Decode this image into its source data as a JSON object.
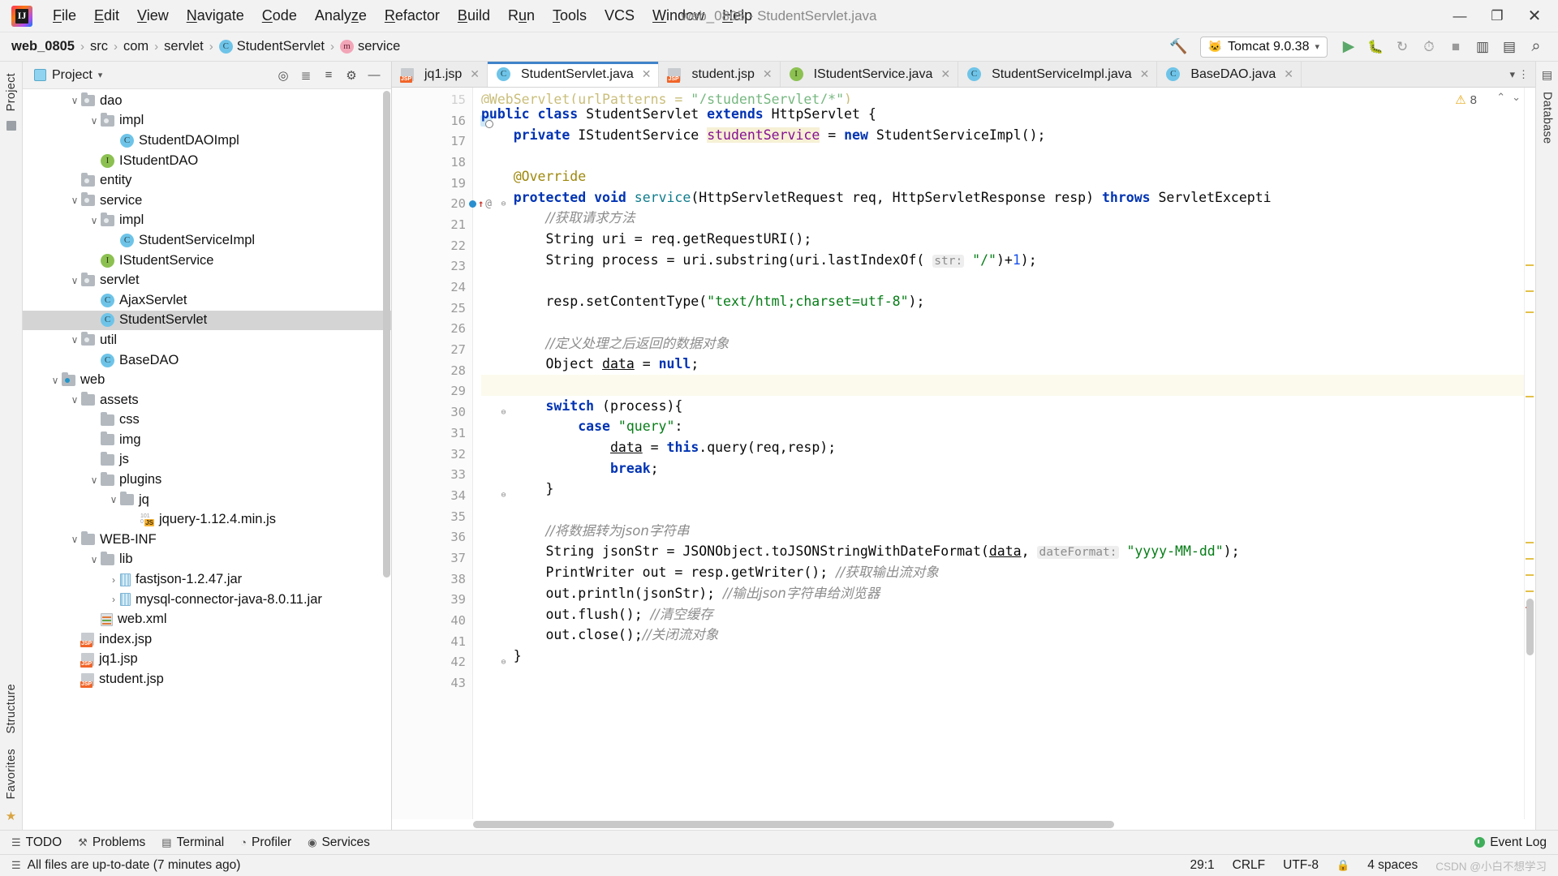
{
  "window": {
    "title": "web_0805 - StudentServlet.java",
    "minimize": "—",
    "maximize": "❐",
    "close": "✕"
  },
  "menu": {
    "items": [
      {
        "pre": "",
        "mn": "F",
        "post": "ile"
      },
      {
        "pre": "",
        "mn": "E",
        "post": "dit"
      },
      {
        "pre": "",
        "mn": "V",
        "post": "iew"
      },
      {
        "pre": "",
        "mn": "N",
        "post": "avigate"
      },
      {
        "pre": "",
        "mn": "C",
        "post": "ode"
      },
      {
        "pre": "Analy",
        "mn": "z",
        "post": "e"
      },
      {
        "pre": "",
        "mn": "R",
        "post": "efactor"
      },
      {
        "pre": "",
        "mn": "B",
        "post": "uild"
      },
      {
        "pre": "R",
        "mn": "u",
        "post": "n"
      },
      {
        "pre": "",
        "mn": "T",
        "post": "ools"
      },
      {
        "pre": "VCS",
        "mn": "",
        "post": ""
      },
      {
        "pre": "",
        "mn": "W",
        "post": "indow"
      },
      {
        "pre": "",
        "mn": "H",
        "post": "elp"
      }
    ]
  },
  "breadcrumb": [
    {
      "label": "web_0805",
      "icon": "",
      "bold": true
    },
    {
      "label": "src",
      "icon": "",
      "bold": false
    },
    {
      "label": "com",
      "icon": "",
      "bold": false
    },
    {
      "label": "servlet",
      "icon": "",
      "bold": false
    },
    {
      "label": "StudentServlet",
      "icon": "class",
      "bold": false
    },
    {
      "label": "service",
      "icon": "method",
      "bold": false
    }
  ],
  "run_toolbar": {
    "build_icon": "hammer-icon",
    "config_name": "Tomcat 9.0.38",
    "config_icon": "tomcat-cat-icon",
    "dropdown_caret": "▾",
    "run_icon": "▶",
    "debug_icon": "debug-icon",
    "rerun_icon": "↻",
    "profile_icon": "⏱",
    "stop_icon": "■",
    "layout_icon": "▥",
    "preview_icon": "▤",
    "search_icon": "⌕"
  },
  "left_rail": {
    "top_label": "Project",
    "bottom_labels": [
      "Structure",
      "Favorites"
    ],
    "star_icon": "★"
  },
  "right_rail": {
    "labels": [
      "Database"
    ],
    "menu_icon": "▤"
  },
  "project_panel": {
    "title": "Project",
    "caret": "▾",
    "icons": [
      "target-icon",
      "collapse-all-icon",
      "expand-icon",
      "gear-icon",
      "hide-icon"
    ],
    "tree": [
      {
        "label": "dao",
        "depth": 2,
        "arrow": "v",
        "icon": "folder"
      },
      {
        "label": "impl",
        "depth": 3,
        "arrow": "v",
        "icon": "folder"
      },
      {
        "label": "StudentDAOImpl",
        "depth": 4,
        "arrow": "",
        "icon": "class"
      },
      {
        "label": "IStudentDAO",
        "depth": 3,
        "arrow": "",
        "icon": "interface"
      },
      {
        "label": "entity",
        "depth": 2,
        "arrow": "",
        "icon": "folder"
      },
      {
        "label": "service",
        "depth": 2,
        "arrow": "v",
        "icon": "folder"
      },
      {
        "label": "impl",
        "depth": 3,
        "arrow": "v",
        "icon": "folder"
      },
      {
        "label": "StudentServiceImpl",
        "depth": 4,
        "arrow": "",
        "icon": "class"
      },
      {
        "label": "IStudentService",
        "depth": 3,
        "arrow": "",
        "icon": "interface"
      },
      {
        "label": "servlet",
        "depth": 2,
        "arrow": "v",
        "icon": "folder"
      },
      {
        "label": "AjaxServlet",
        "depth": 3,
        "arrow": "",
        "icon": "class"
      },
      {
        "label": "StudentServlet",
        "depth": 3,
        "arrow": "",
        "icon": "class",
        "selected": true
      },
      {
        "label": "util",
        "depth": 2,
        "arrow": "v",
        "icon": "folder"
      },
      {
        "label": "BaseDAO",
        "depth": 3,
        "arrow": "",
        "icon": "class"
      },
      {
        "label": "web",
        "depth": 1,
        "arrow": "v",
        "icon": "folder-web"
      },
      {
        "label": "assets",
        "depth": 2,
        "arrow": "v",
        "icon": "folder-plain"
      },
      {
        "label": "css",
        "depth": 3,
        "arrow": "",
        "icon": "folder-plain"
      },
      {
        "label": "img",
        "depth": 3,
        "arrow": "",
        "icon": "folder-plain"
      },
      {
        "label": "js",
        "depth": 3,
        "arrow": "",
        "icon": "folder-plain"
      },
      {
        "label": "plugins",
        "depth": 3,
        "arrow": "v",
        "icon": "folder-plain"
      },
      {
        "label": "jq",
        "depth": 4,
        "arrow": "v",
        "icon": "folder-plain"
      },
      {
        "label": "jquery-1.12.4.min.js",
        "depth": 5,
        "arrow": "",
        "icon": "js"
      },
      {
        "label": "WEB-INF",
        "depth": 2,
        "arrow": "v",
        "icon": "folder-plain"
      },
      {
        "label": "lib",
        "depth": 3,
        "arrow": "v",
        "icon": "folder-plain"
      },
      {
        "label": "fastjson-1.2.47.jar",
        "depth": 4,
        "arrow": ">",
        "icon": "jar"
      },
      {
        "label": "mysql-connector-java-8.0.11.jar",
        "depth": 4,
        "arrow": ">",
        "icon": "jar"
      },
      {
        "label": "web.xml",
        "depth": 3,
        "arrow": "",
        "icon": "xml"
      },
      {
        "label": "index.jsp",
        "depth": 2,
        "arrow": "",
        "icon": "jsp"
      },
      {
        "label": "jq1.jsp",
        "depth": 2,
        "arrow": "",
        "icon": "jsp"
      },
      {
        "label": "student.jsp",
        "depth": 2,
        "arrow": "",
        "icon": "jsp"
      }
    ]
  },
  "editor_tabs": [
    {
      "label": "jq1.jsp",
      "icon": "jsp",
      "active": false,
      "close": "✕"
    },
    {
      "label": "StudentServlet.java",
      "icon": "class",
      "active": true,
      "close": "✕"
    },
    {
      "label": "student.jsp",
      "icon": "jsp",
      "active": false,
      "close": "✕"
    },
    {
      "label": "IStudentService.java",
      "icon": "interface",
      "active": false,
      "close": "✕"
    },
    {
      "label": "StudentServiceImpl.java",
      "icon": "class",
      "active": false,
      "close": "✕"
    },
    {
      "label": "BaseDAO.java",
      "icon": "class",
      "active": false,
      "close": "✕"
    }
  ],
  "editor": {
    "warning_count": "8",
    "warning_icon": "warning-triangle-icon",
    "nav_up": "⌃",
    "nav_down": "⌄",
    "first_line_number": 15,
    "cursor_line_index": 14,
    "lines": [
      {
        "n": 15,
        "tokens": [
          {
            "t": "@WebServlet(urlPatterns = ",
            "c": "anno"
          },
          {
            "t": "\"/studentServlet/*\"",
            "c": "str"
          },
          {
            "t": ")",
            "c": "anno"
          }
        ],
        "clipped_top": true
      },
      {
        "n": 16,
        "tokens": [
          {
            "t": "public ",
            "c": "kw"
          },
          {
            "t": "class ",
            "c": "kw"
          },
          {
            "t": "StudentServlet ",
            "c": ""
          },
          {
            "t": "extends ",
            "c": "kw"
          },
          {
            "t": "HttpServlet {",
            "c": ""
          }
        ],
        "gutter": "override"
      },
      {
        "n": 17,
        "tokens": [
          {
            "t": "    ",
            "c": ""
          },
          {
            "t": "private ",
            "c": "kw"
          },
          {
            "t": "IStudentService ",
            "c": ""
          },
          {
            "t": "studentService",
            "c": "fld-hl"
          },
          {
            "t": " = ",
            "c": ""
          },
          {
            "t": "new ",
            "c": "kw"
          },
          {
            "t": "StudentServiceImpl();",
            "c": ""
          }
        ]
      },
      {
        "n": 18,
        "tokens": []
      },
      {
        "n": 19,
        "tokens": [
          {
            "t": "    ",
            "c": ""
          },
          {
            "t": "@Override",
            "c": "anno"
          }
        ]
      },
      {
        "n": 20,
        "tokens": [
          {
            "t": "    ",
            "c": ""
          },
          {
            "t": "protected ",
            "c": "kw"
          },
          {
            "t": "void ",
            "c": "kw"
          },
          {
            "t": "service",
            "c": "typ"
          },
          {
            "t": "(HttpServletRequest req, HttpServletResponse resp) ",
            "c": ""
          },
          {
            "t": "throws ",
            "c": "kw"
          },
          {
            "t": "ServletExcepti",
            "c": ""
          }
        ],
        "gutter": "impl",
        "fold": true
      },
      {
        "n": 21,
        "tokens": [
          {
            "t": "        ",
            "c": ""
          },
          {
            "t": "//获取请求方法",
            "c": "cmt-zh"
          }
        ]
      },
      {
        "n": 22,
        "tokens": [
          {
            "t": "        String uri = req.getRequestURI();",
            "c": ""
          }
        ]
      },
      {
        "n": 23,
        "tokens": [
          {
            "t": "        String process = uri.substring(uri.lastIndexOf( ",
            "c": ""
          },
          {
            "t": "str:",
            "c": "hint"
          },
          {
            "t": " ",
            "c": ""
          },
          {
            "t": "\"/\"",
            "c": "str"
          },
          {
            "t": ")+",
            "c": ""
          },
          {
            "t": "1",
            "c": "num"
          },
          {
            "t": ");",
            "c": ""
          }
        ]
      },
      {
        "n": 24,
        "tokens": []
      },
      {
        "n": 25,
        "tokens": [
          {
            "t": "        resp.setContentType(",
            "c": ""
          },
          {
            "t": "\"text/html;charset=utf-8\"",
            "c": "str"
          },
          {
            "t": ");",
            "c": ""
          }
        ]
      },
      {
        "n": 26,
        "tokens": []
      },
      {
        "n": 27,
        "tokens": [
          {
            "t": "        ",
            "c": ""
          },
          {
            "t": "//定义处理之后返回的数据对象",
            "c": "cmt-zh"
          }
        ]
      },
      {
        "n": 28,
        "tokens": [
          {
            "t": "        Object ",
            "c": ""
          },
          {
            "t": "data",
            "c": "underline"
          },
          {
            "t": " = ",
            "c": ""
          },
          {
            "t": "null",
            "c": "kw"
          },
          {
            "t": ";",
            "c": ""
          }
        ]
      },
      {
        "n": 29,
        "tokens": [],
        "cursor": true
      },
      {
        "n": 30,
        "tokens": [
          {
            "t": "        ",
            "c": ""
          },
          {
            "t": "switch",
            "c": "kw-hl"
          },
          {
            "t": " (process){",
            "c": ""
          }
        ],
        "fold": true
      },
      {
        "n": 31,
        "tokens": [
          {
            "t": "            ",
            "c": ""
          },
          {
            "t": "case ",
            "c": "kw"
          },
          {
            "t": "\"query\"",
            "c": "str"
          },
          {
            "t": ":",
            "c": ""
          }
        ]
      },
      {
        "n": 32,
        "tokens": [
          {
            "t": "                ",
            "c": ""
          },
          {
            "t": "data",
            "c": "underline"
          },
          {
            "t": " = ",
            "c": ""
          },
          {
            "t": "this",
            "c": "kw"
          },
          {
            "t": ".query(req,resp);",
            "c": ""
          }
        ]
      },
      {
        "n": 33,
        "tokens": [
          {
            "t": "                ",
            "c": ""
          },
          {
            "t": "break",
            "c": "kw"
          },
          {
            "t": ";",
            "c": ""
          }
        ]
      },
      {
        "n": 34,
        "tokens": [
          {
            "t": "        }",
            "c": ""
          }
        ],
        "fold": true
      },
      {
        "n": 35,
        "tokens": []
      },
      {
        "n": 36,
        "tokens": [
          {
            "t": "        ",
            "c": ""
          },
          {
            "t": "//将数据转为json字符串",
            "c": "cmt-zh"
          }
        ]
      },
      {
        "n": 37,
        "tokens": [
          {
            "t": "        String jsonStr = JSONObject.toJSONStringWithDateFormat(",
            "c": ""
          },
          {
            "t": "data",
            "c": "underline"
          },
          {
            "t": ", ",
            "c": ""
          },
          {
            "t": "dateFormat:",
            "c": "hint"
          },
          {
            "t": " ",
            "c": ""
          },
          {
            "t": "\"yyyy-MM-dd\"",
            "c": "str"
          },
          {
            "t": ");",
            "c": ""
          }
        ]
      },
      {
        "n": 38,
        "tokens": [
          {
            "t": "        PrintWriter out = resp.getWriter(); ",
            "c": ""
          },
          {
            "t": "//获取输出流对象",
            "c": "cmt-zh"
          }
        ]
      },
      {
        "n": 39,
        "tokens": [
          {
            "t": "        out.println(jsonStr); ",
            "c": ""
          },
          {
            "t": "//输出json字符串给浏览器",
            "c": "cmt-zh"
          }
        ]
      },
      {
        "n": 40,
        "tokens": [
          {
            "t": "        out.flush(); ",
            "c": ""
          },
          {
            "t": "//清空缓存",
            "c": "cmt-zh"
          }
        ]
      },
      {
        "n": 41,
        "tokens": [
          {
            "t": "        out.close();",
            "c": ""
          },
          {
            "t": "//关闭流对象",
            "c": "cmt-zh"
          }
        ]
      },
      {
        "n": 42,
        "tokens": [
          {
            "t": "    }",
            "c": ""
          }
        ],
        "fold": true
      },
      {
        "n": 43,
        "tokens": []
      }
    ]
  },
  "toolwindow_bar": {
    "items": [
      {
        "label": "TODO",
        "icon": "list-icon"
      },
      {
        "label": "Problems",
        "icon": "wrench-icon"
      },
      {
        "label": "Terminal",
        "icon": "terminal-icon"
      },
      {
        "label": "Profiler",
        "icon": "profiler-icon"
      },
      {
        "label": "Services",
        "icon": "services-icon"
      }
    ],
    "event_log": "Event Log",
    "event_icon": "event-log-icon"
  },
  "statusbar": {
    "message": "All files are up-to-date (7 minutes ago)",
    "caret_position": "29:1",
    "line_separator": "CRLF",
    "encoding": "UTF-8",
    "indent": "4 spaces",
    "lock_icon": "🔒",
    "watermark": "CSDN @小白不想学习"
  }
}
